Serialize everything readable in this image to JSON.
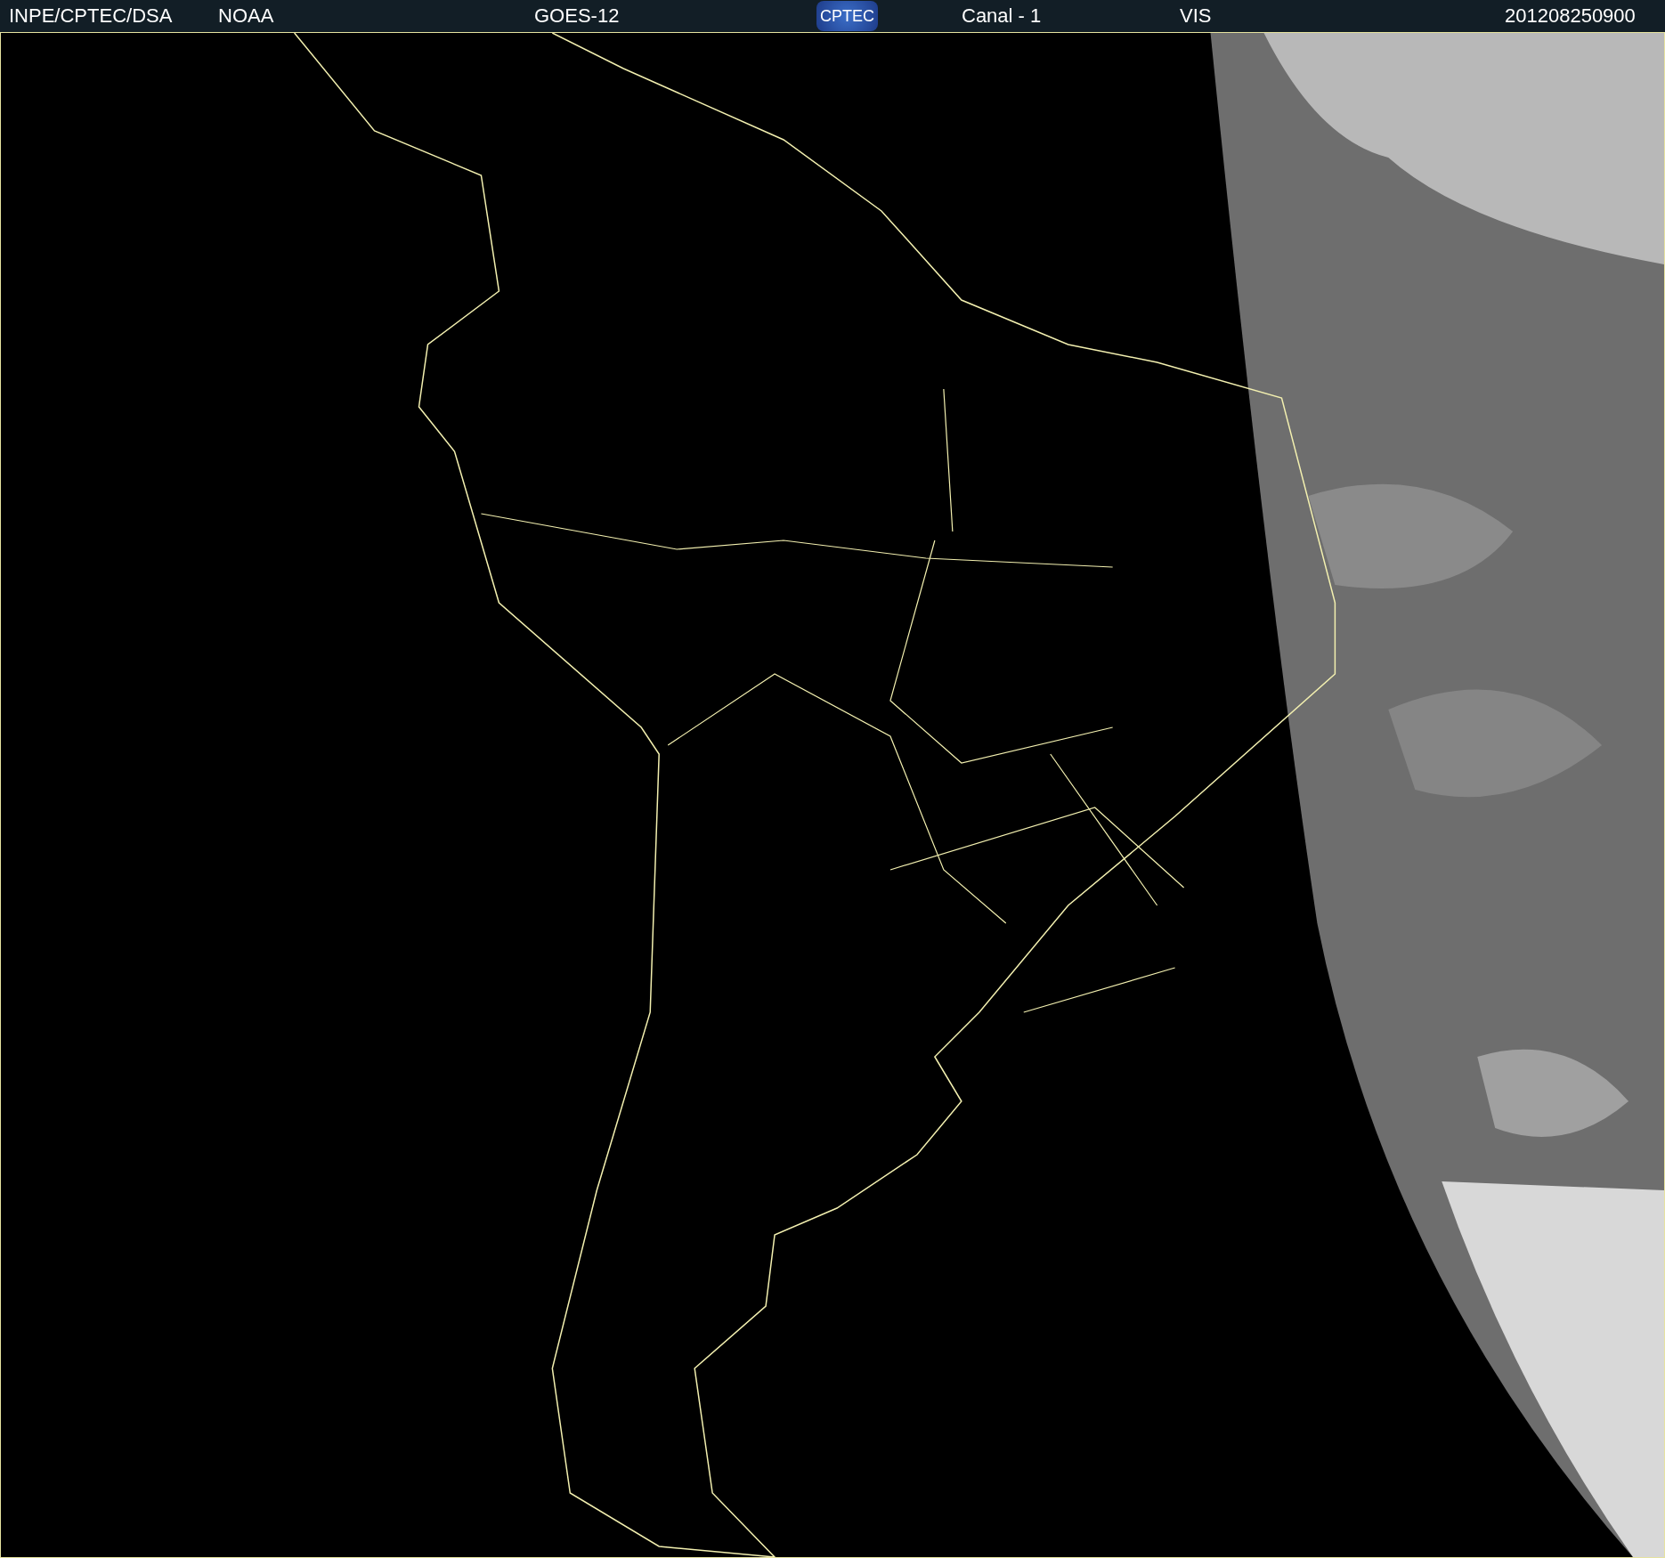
{
  "header": {
    "items": [
      {
        "kind": "text",
        "text": "INPE/CPTEC/DSA"
      },
      {
        "kind": "text",
        "text": "NOAA"
      },
      {
        "kind": "text",
        "text": "GOES-12"
      },
      {
        "kind": "logo",
        "text": "CPTEC"
      },
      {
        "kind": "text",
        "text": "Canal - 1"
      },
      {
        "kind": "text",
        "text": "VIS"
      },
      {
        "kind": "text",
        "text": "201208250900"
      }
    ]
  }
}
